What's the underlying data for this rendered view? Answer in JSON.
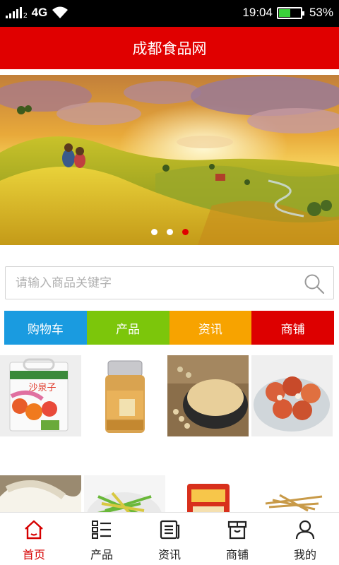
{
  "status_bar": {
    "network": "4G",
    "sim_label": "2",
    "time": "19:04",
    "battery_percent": "53%",
    "battery_level": 0.53,
    "battery_color": "#3ad23a"
  },
  "header": {
    "title": "成都食品网",
    "color": "#e00000"
  },
  "banner": {
    "slide_count": 3,
    "active_slide": 3,
    "active_dot_color": "#e00000"
  },
  "search": {
    "placeholder": "请输入商品关键字",
    "value": ""
  },
  "nav_blocks": [
    {
      "label": "购物车",
      "color": "#1a9be0"
    },
    {
      "label": "产品",
      "color": "#7cc60b"
    },
    {
      "label": "资讯",
      "color": "#f7a300"
    },
    {
      "label": "商铺",
      "color": "#dd0000"
    }
  ],
  "products": [
    {
      "package_text": "沙泉子"
    },
    {
      "package_text": ""
    },
    {
      "package_text": ""
    },
    {
      "package_text": ""
    },
    {
      "package_text": ""
    },
    {
      "package_text": ""
    },
    {
      "package_text": ""
    },
    {
      "package_text": ""
    }
  ],
  "tab_bar": {
    "active_color": "#d60000",
    "items": [
      {
        "label": "首页",
        "icon": "home-icon",
        "active": true
      },
      {
        "label": "产品",
        "icon": "list-icon",
        "active": false
      },
      {
        "label": "资讯",
        "icon": "news-icon",
        "active": false
      },
      {
        "label": "商铺",
        "icon": "shop-icon",
        "active": false
      },
      {
        "label": "我的",
        "icon": "user-icon",
        "active": false
      }
    ]
  }
}
